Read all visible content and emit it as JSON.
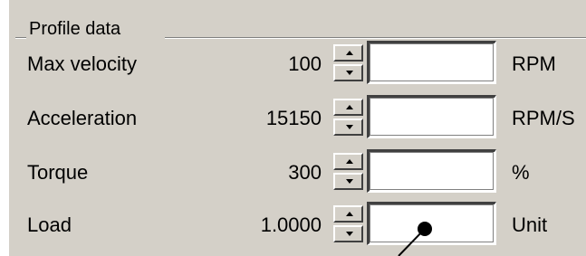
{
  "group": {
    "title": "Profile data"
  },
  "rows": [
    {
      "label": "Max velocity",
      "value": "100",
      "unit": "RPM",
      "input": ""
    },
    {
      "label": "Acceleration",
      "value": "15150",
      "unit": "RPM/S",
      "input": ""
    },
    {
      "label": "Torque",
      "value": "300",
      "unit": "%",
      "input": ""
    },
    {
      "label": "Load",
      "value": "1.0000",
      "unit": "Unit",
      "input": ""
    }
  ]
}
